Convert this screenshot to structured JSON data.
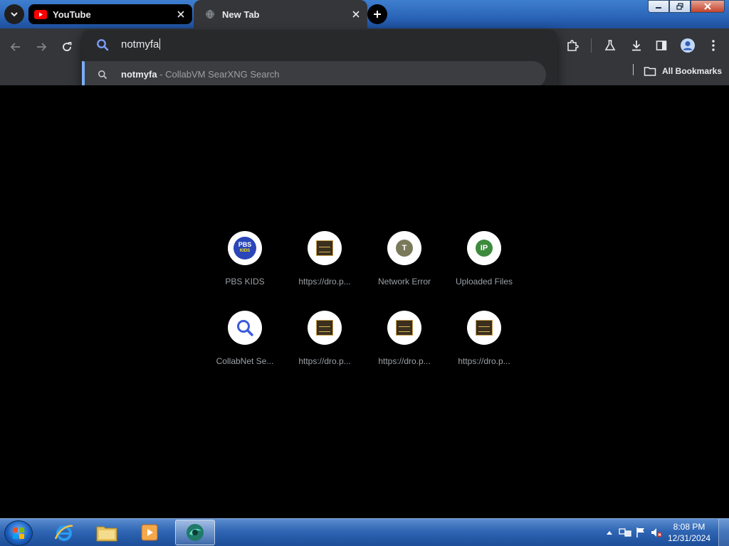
{
  "tabs": [
    {
      "title": "YouTube",
      "favicon": "youtube-icon",
      "active": false
    },
    {
      "title": "New Tab",
      "favicon": "globe-icon",
      "active": true
    }
  ],
  "omnibox": {
    "input_value": "notmyfa",
    "suggestion": {
      "query": "notmyfa",
      "separator": " - ",
      "description": "CollabVM SearXNG Search"
    }
  },
  "bookmarks_bar": {
    "all_bookmarks_label": "All Bookmarks"
  },
  "shortcuts": [
    {
      "label": "PBS KIDS",
      "icon": "pbs-kids-logo",
      "badge_text": "PBS",
      "badge_sub": "KIDS"
    },
    {
      "label": "https://dro.p...",
      "icon": "thumbnail-image"
    },
    {
      "label": "Network Error",
      "icon": "letter-badge",
      "letter": "T",
      "color": "#7a7a5a"
    },
    {
      "label": "Uploaded Files",
      "icon": "letter-badge",
      "letter": "IP",
      "color": "#3d8a3d"
    },
    {
      "label": "CollabNet Se...",
      "icon": "search-icon"
    },
    {
      "label": "https://dro.p...",
      "icon": "thumbnail-image"
    },
    {
      "label": "https://dro.p...",
      "icon": "thumbnail-image"
    },
    {
      "label": "https://dro.p...",
      "icon": "thumbnail-image"
    }
  ],
  "taskbar": {
    "apps": [
      "internet-explorer-icon",
      "file-explorer-icon",
      "media-player-icon",
      "browser-icon"
    ],
    "clock_time": "8:08 PM",
    "clock_date": "12/31/2024"
  },
  "colors": {
    "accent": "#7cacf8",
    "toolbar": "#35363a",
    "omnibox": "#28292a",
    "ntp_background": "#000000"
  }
}
